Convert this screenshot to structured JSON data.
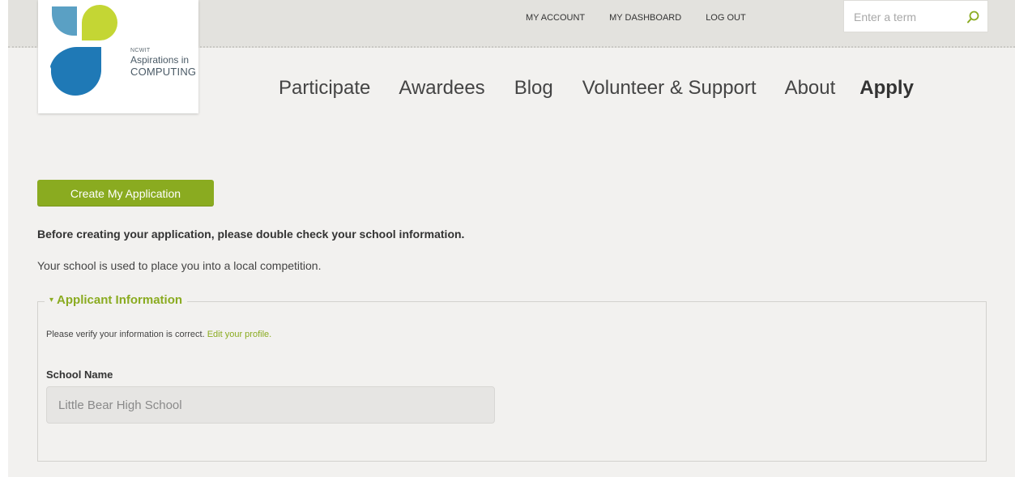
{
  "brand": {
    "org_small": "NCWIT",
    "name_line1": "Aspirations in",
    "name_line2": "COMPUTING",
    "colors": {
      "teal": "#5aa0c4",
      "lime": "#c4d634",
      "blue": "#1f79b6",
      "accent_green": "#8aab20"
    }
  },
  "utility_nav": {
    "account": "MY ACCOUNT",
    "dashboard": "MY DASHBOARD",
    "logout": "LOG OUT"
  },
  "search": {
    "placeholder": "Enter a term",
    "icon": "search-icon"
  },
  "main_nav": {
    "items": [
      "Participate",
      "Awardees",
      "Blog",
      "Volunteer & Support",
      "About",
      "Apply"
    ],
    "active": "Apply"
  },
  "content": {
    "create_button": "Create My Application",
    "intro_bold": "Before creating your application, please double check your school information.",
    "intro_text": "Your school is used to place you into a local competition.",
    "fieldset": {
      "legend": "Applicant Information",
      "verify_text": "Please verify your information is correct.",
      "edit_link": "Edit your profile.",
      "school_label": "School Name",
      "school_value": "Little Bear High School"
    }
  }
}
